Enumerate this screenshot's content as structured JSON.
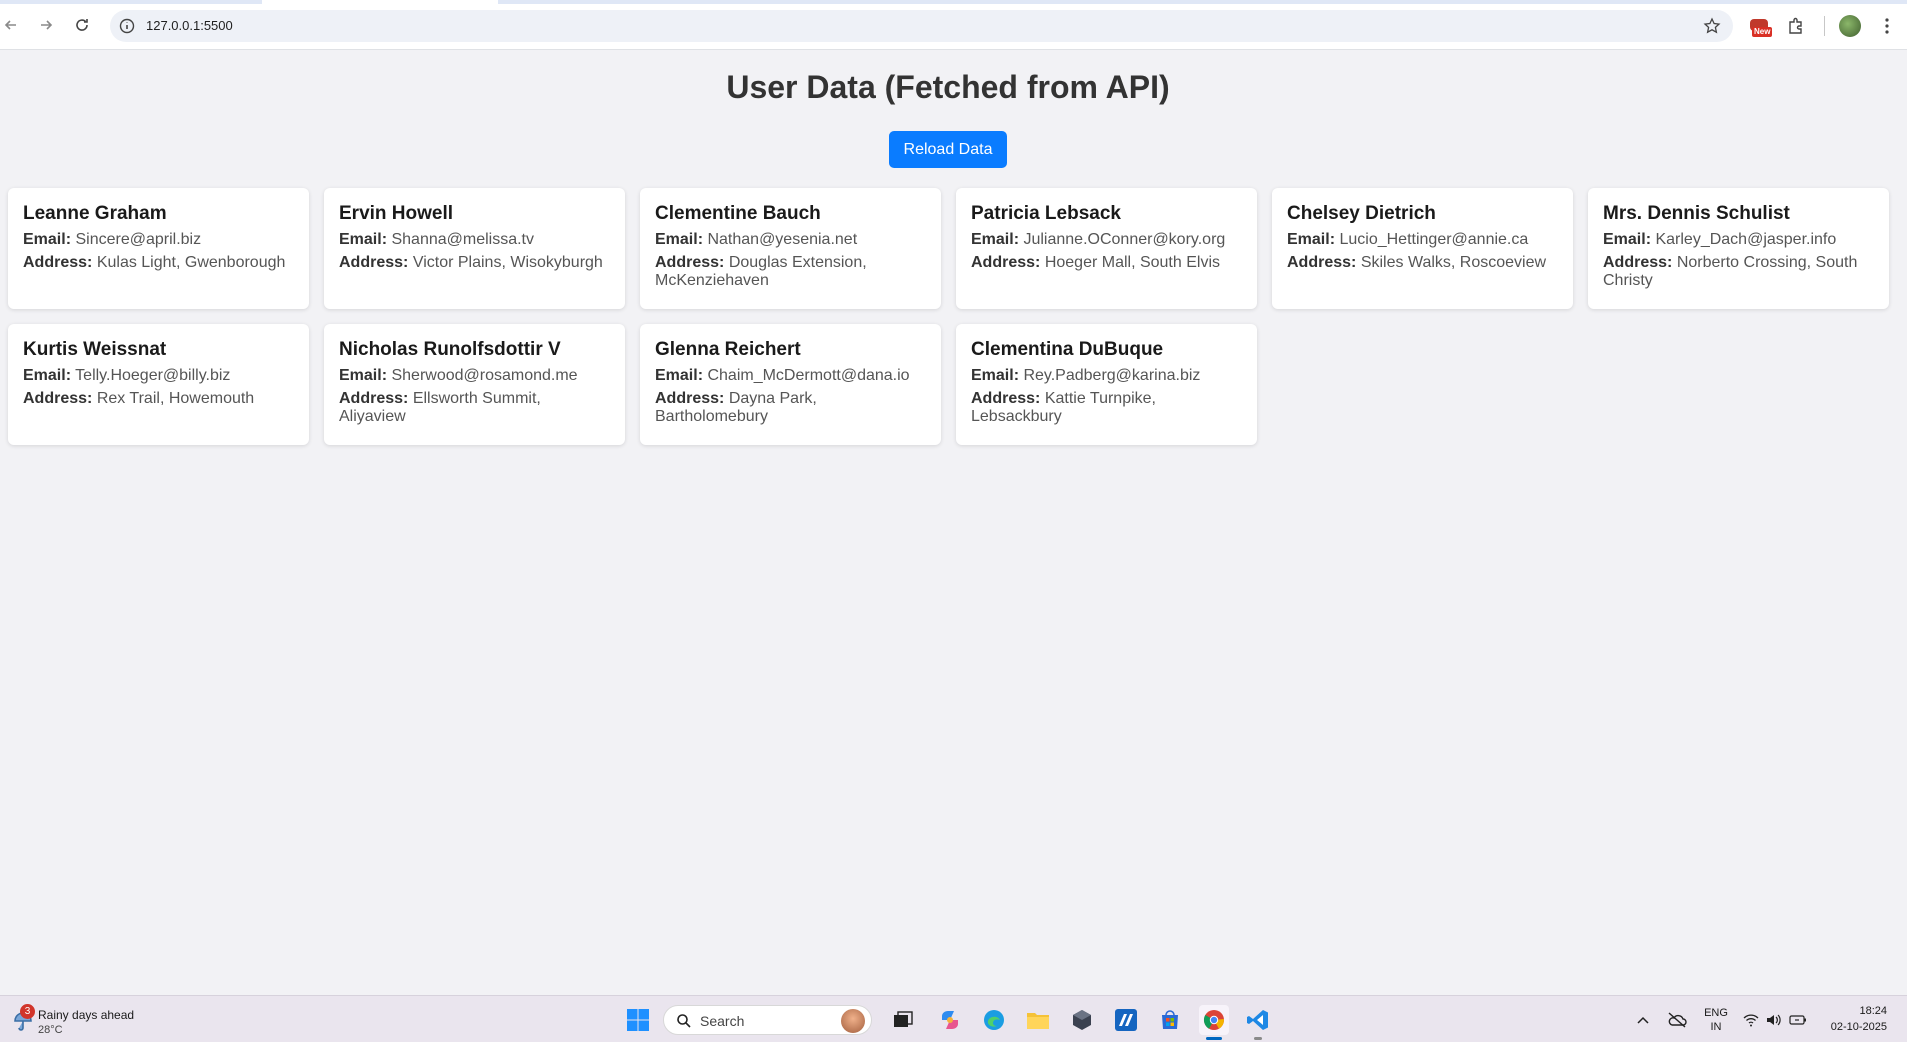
{
  "browser": {
    "url": "127.0.0.1:5500",
    "extension_badge": "New"
  },
  "page": {
    "title": "User Data (Fetched from API)",
    "reload_label": "Reload Data",
    "email_label": "Email:",
    "address_label": "Address:"
  },
  "users": [
    {
      "name": "Leanne Graham",
      "email": "Sincere@april.biz",
      "address": "Kulas Light, Gwenborough"
    },
    {
      "name": "Ervin Howell",
      "email": "Shanna@melissa.tv",
      "address": "Victor Plains, Wisokyburgh"
    },
    {
      "name": "Clementine Bauch",
      "email": "Nathan@yesenia.net",
      "address": "Douglas Extension, McKenziehaven"
    },
    {
      "name": "Patricia Lebsack",
      "email": "Julianne.OConner@kory.org",
      "address": "Hoeger Mall, South Elvis"
    },
    {
      "name": "Chelsey Dietrich",
      "email": "Lucio_Hettinger@annie.ca",
      "address": "Skiles Walks, Roscoeview"
    },
    {
      "name": "Mrs. Dennis Schulist",
      "email": "Karley_Dach@jasper.info",
      "address": "Norberto Crossing, South Christy"
    },
    {
      "name": "Kurtis Weissnat",
      "email": "Telly.Hoeger@billy.biz",
      "address": "Rex Trail, Howemouth"
    },
    {
      "name": "Nicholas Runolfsdottir V",
      "email": "Sherwood@rosamond.me",
      "address": "Ellsworth Summit, Aliyaview"
    },
    {
      "name": "Glenna Reichert",
      "email": "Chaim_McDermott@dana.io",
      "address": "Dayna Park, Bartholomebury"
    },
    {
      "name": "Clementina DuBuque",
      "email": "Rey.Padberg@karina.biz",
      "address": "Kattie Turnpike, Lebsackbury"
    }
  ],
  "taskbar": {
    "weather_badge": "3",
    "weather_title": "Rainy days ahead",
    "weather_temp": "28°C",
    "search_placeholder": "Search",
    "lang_line1": "ENG",
    "lang_line2": "IN",
    "time": "18:24",
    "date": "02-10-2025"
  },
  "colors": {
    "accent": "#0a7cff",
    "page_bg": "#f2f2f5",
    "card_bg": "#ffffff"
  }
}
